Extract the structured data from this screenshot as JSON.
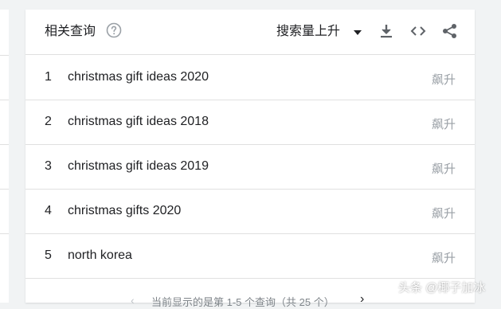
{
  "widget": {
    "title": "相关查询",
    "help_icon": "help-circle-icon",
    "sort_label": "搜索量上升",
    "toolbar_icons": [
      "download-icon",
      "embed-code-icon",
      "share-icon"
    ]
  },
  "rows": [
    {
      "rank": "1",
      "query": "christmas gift ideas 2020",
      "value": "飙升"
    },
    {
      "rank": "2",
      "query": "christmas gift ideas 2018",
      "value": "飙升"
    },
    {
      "rank": "3",
      "query": "christmas gift ideas 2019",
      "value": "飙升"
    },
    {
      "rank": "4",
      "query": "christmas gifts 2020",
      "value": "飙升"
    },
    {
      "rank": "5",
      "query": "north korea",
      "value": "飙升"
    }
  ],
  "pager": {
    "status": "当前显示的是第 1-5 个查询（共 25 个）"
  },
  "watermark": "头条 @椰子加冰",
  "colors": {
    "background": "#f1f3f4",
    "card": "#ffffff",
    "muted": "#9aa0a6",
    "divider": "#e0e0e0"
  }
}
